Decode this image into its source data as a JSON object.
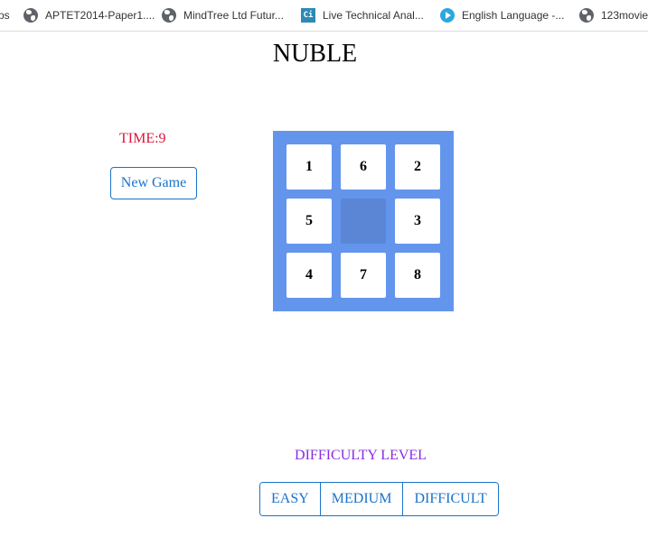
{
  "bookmarks": [
    {
      "label": "ps",
      "icon": "none"
    },
    {
      "label": "APTET2014-Paper1....",
      "icon": "globe-icon"
    },
    {
      "label": "MindTree Ltd Futur...",
      "icon": "globe-icon"
    },
    {
      "label": "Live Technical Anal...",
      "icon": "ci-icon",
      "icon_text": "Ci"
    },
    {
      "label": "English Language -...",
      "icon": "play-icon"
    },
    {
      "label": "123movie",
      "icon": "globe-icon"
    }
  ],
  "game": {
    "title": "NUBLE",
    "timer_label": "TIME:9",
    "new_game_label": "New Game",
    "tiles": [
      "1",
      "6",
      "2",
      "5",
      "",
      "3",
      "4",
      "7",
      "8"
    ]
  },
  "difficulty": {
    "label": "DIFFICULTY LEVEL",
    "options": [
      "EASY",
      "MEDIUM",
      "DIFFICULT"
    ]
  },
  "colors": {
    "board": "#6495ed",
    "empty_tile": "#5b86d6",
    "timer": "#dc143c",
    "accent": "#1a73c9",
    "difficulty_label": "#8a2be2"
  }
}
